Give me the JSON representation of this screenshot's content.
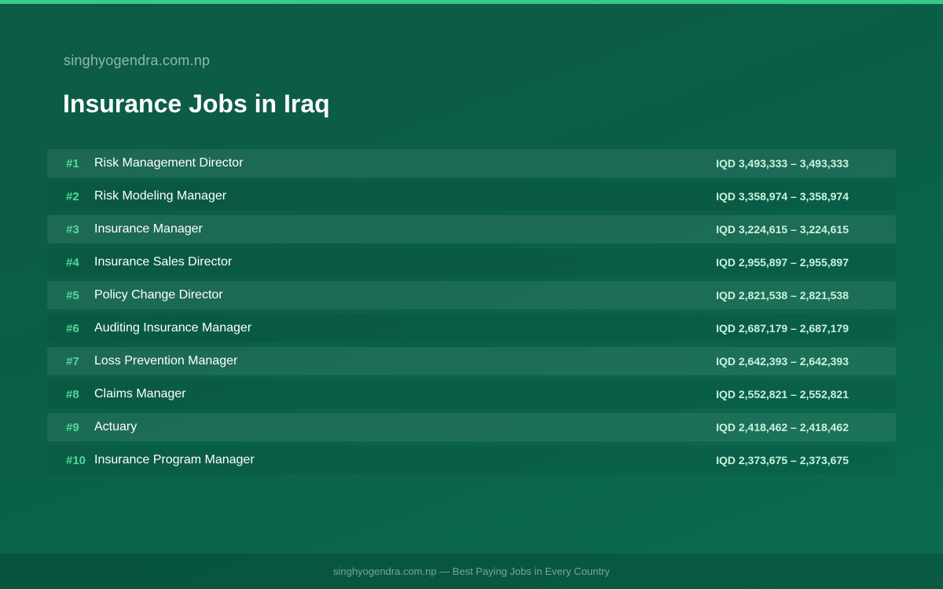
{
  "header": {
    "site_name": "singhyogendra.com.np",
    "title": "Insurance Jobs in Iraq"
  },
  "jobs": [
    {
      "rank": "#1",
      "title": "Risk Management Director",
      "salary": "IQD 3,493,333 – 3,493,333"
    },
    {
      "rank": "#2",
      "title": "Risk Modeling Manager",
      "salary": "IQD 3,358,974 – 3,358,974"
    },
    {
      "rank": "#3",
      "title": "Insurance Manager",
      "salary": "IQD 3,224,615 – 3,224,615"
    },
    {
      "rank": "#4",
      "title": "Insurance Sales Director",
      "salary": "IQD 2,955,897 – 2,955,897"
    },
    {
      "rank": "#5",
      "title": "Policy Change Director",
      "salary": "IQD 2,821,538 – 2,821,538"
    },
    {
      "rank": "#6",
      "title": "Auditing Insurance Manager",
      "salary": "IQD 2,687,179 – 2,687,179"
    },
    {
      "rank": "#7",
      "title": "Loss Prevention Manager",
      "salary": "IQD 2,642,393 – 2,642,393"
    },
    {
      "rank": "#8",
      "title": "Claims Manager",
      "salary": "IQD 2,552,821 – 2,552,821"
    },
    {
      "rank": "#9",
      "title": "Actuary",
      "salary": "IQD 2,418,462 – 2,418,462"
    },
    {
      "rank": "#10",
      "title": "Insurance Program Manager",
      "salary": "IQD 2,373,675 – 2,373,675"
    }
  ],
  "footer": {
    "text": "singhyogendra.com.np — Best Paying Jobs in Every Country"
  },
  "colors": {
    "accent": "#36c98a",
    "rank": "#4fd79a",
    "background": "#0a5f48"
  }
}
